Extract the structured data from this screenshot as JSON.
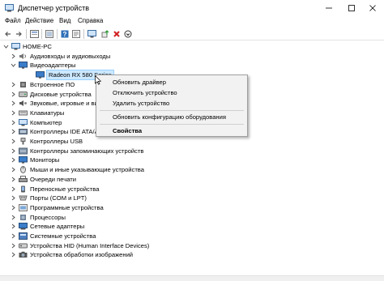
{
  "window": {
    "title": "Диспетчер устройств"
  },
  "menu": [
    "Файл",
    "Действие",
    "Вид",
    "Справка"
  ],
  "toolbar": {
    "icons": [
      "back-icon",
      "forward-icon",
      "properties-icon",
      "show-hidden-icon",
      "help-icon",
      "properties-sheet-icon",
      "scan-hardware-icon",
      "update-driver-icon",
      "uninstall-icon",
      "disable-icon"
    ]
  },
  "tree": {
    "root": "HOME-PC",
    "items": [
      "Аудиовходы и аудиовыходы",
      "Видеоадаптеры",
      "Radeon RX 580 Series",
      "Встроенное ПО",
      "Дисковые устройства",
      "Звуковые, игровые и видеоустройства",
      "Клавиатуры",
      "Компьютер",
      "Контроллеры IDE ATA/ATAPI",
      "Контроллеры USB",
      "Контроллеры запоминающих устройств",
      "Мониторы",
      "Мыши и иные указывающие устройства",
      "Очереди печати",
      "Переносные устройства",
      "Порты (COM и LPT)",
      "Программные устройства",
      "Процессоры",
      "Сетевые адаптеры",
      "Системные устройства",
      "Устройства HID (Human Interface Devices)",
      "Устройства обработки изображений"
    ]
  },
  "context_menu": {
    "update_driver": "Обновить драйвер",
    "disable": "Отключить устройство",
    "uninstall": "Удалить устройство",
    "scan": "Обновить конфигурацию оборудования",
    "properties": "Свойства"
  },
  "colors": {
    "selection": "#cce8ff",
    "selection_border": "#99d1ff",
    "menu_bg": "#f2f2f2",
    "delete_red": "#d21f1f",
    "green": "#2e9b3a"
  }
}
